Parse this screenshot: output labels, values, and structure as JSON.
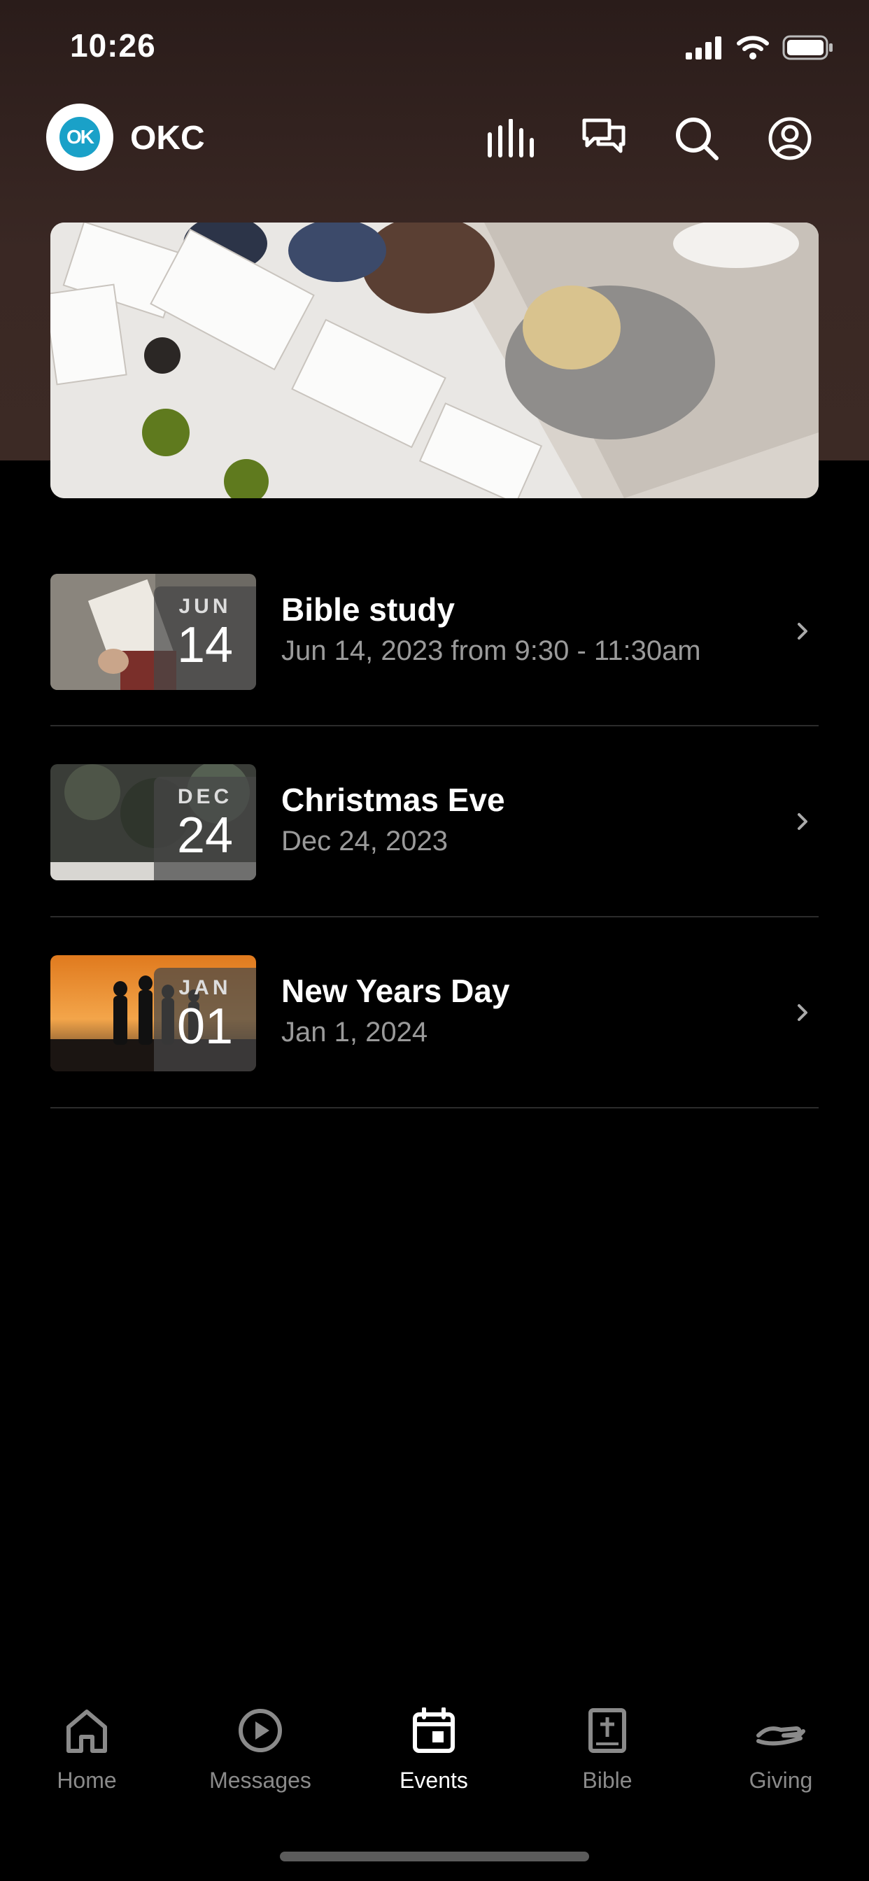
{
  "status_bar": {
    "time": "10:26"
  },
  "header": {
    "brand": "OKC",
    "logo_text": "OK"
  },
  "events": [
    {
      "month": "JUN",
      "day": "14",
      "title": "Bible study",
      "subtitle": "Jun 14, 2023 from 9:30 - 11:30am"
    },
    {
      "month": "DEC",
      "day": "24",
      "title": "Christmas Eve",
      "subtitle": "Dec 24, 2023"
    },
    {
      "month": "JAN",
      "day": "01",
      "title": "New Years Day",
      "subtitle": "Jan 1, 2024"
    }
  ],
  "tabs": [
    {
      "label": "Home",
      "icon": "home-icon",
      "active": false
    },
    {
      "label": "Messages",
      "icon": "play-circle-icon",
      "active": false
    },
    {
      "label": "Events",
      "icon": "calendar-icon",
      "active": true
    },
    {
      "label": "Bible",
      "icon": "bible-icon",
      "active": false
    },
    {
      "label": "Giving",
      "icon": "giving-hand-icon",
      "active": false
    }
  ],
  "colors": {
    "background": "#000000",
    "header_bg": "#3a2824",
    "logo_accent": "#1aa1c8",
    "inactive": "#8a8a8a"
  }
}
